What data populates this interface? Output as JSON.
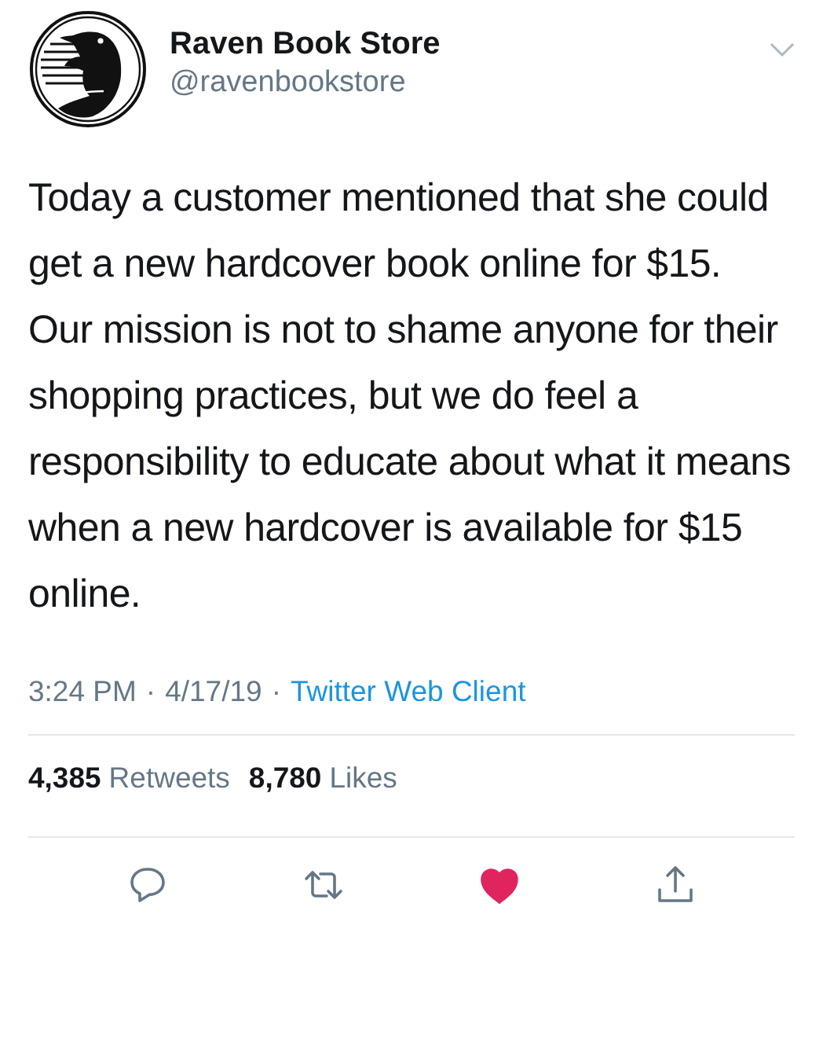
{
  "author": {
    "name": "Raven Book Store",
    "handle": "@ravenbookstore"
  },
  "text": "Today a customer mentioned that she could get a new hardcover book online for $15. Our mission is not to shame anyone for their shopping practices, but we do feel a responsibility to educate about what it means when a new hardcover is available for $15 online.",
  "meta": [
    {
      "text": "3:24 PM",
      "kind": "plain"
    },
    {
      "text": "·",
      "kind": "plain"
    },
    {
      "text": "4/17/19",
      "kind": "plain"
    },
    {
      "text": "·",
      "kind": "plain"
    },
    {
      "text": "Twitter Web Client",
      "kind": "link"
    }
  ],
  "stats": [
    {
      "count": "4,385",
      "label": "Retweets"
    },
    {
      "count": "8,780",
      "label": "Likes"
    }
  ],
  "actions": [
    {
      "kind": "reply",
      "on": false
    },
    {
      "kind": "retweet",
      "on": false
    },
    {
      "kind": "like",
      "on": true
    },
    {
      "kind": "share",
      "on": false
    }
  ]
}
